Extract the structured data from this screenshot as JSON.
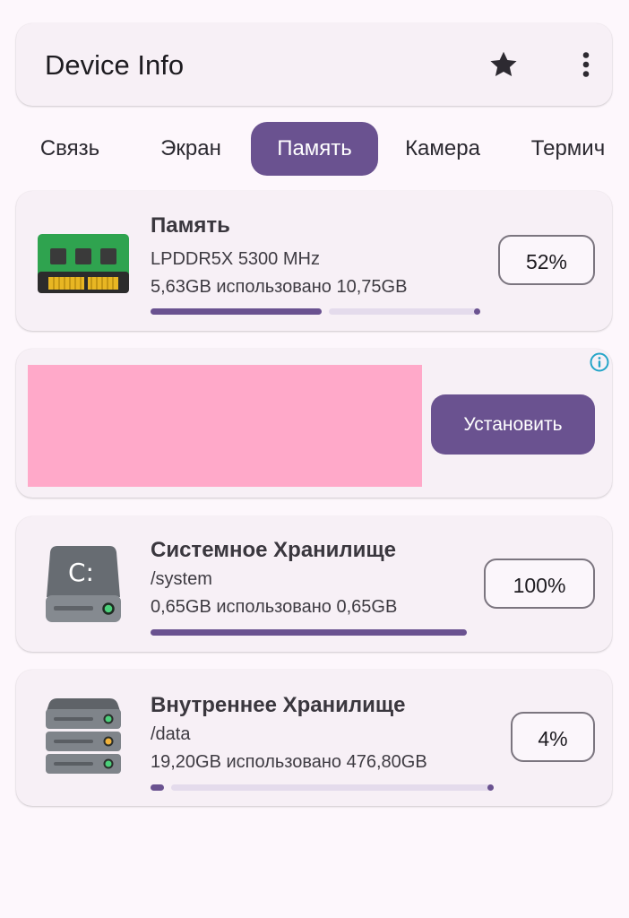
{
  "app": {
    "title": "Device Info",
    "icons": [
      "star-icon",
      "more-vert-icon"
    ]
  },
  "tabs": [
    {
      "label": "Связь",
      "active": false
    },
    {
      "label": "Экран",
      "active": false
    },
    {
      "label": "Память",
      "active": true
    },
    {
      "label": "Камера",
      "active": false
    },
    {
      "label": "Термич",
      "active": false
    }
  ],
  "memory": {
    "title": "Память",
    "type": "LPDDR5X 5300 MHz",
    "usage": "5,63GB использовано 10,75GB",
    "percent_label": "52%",
    "percent": 52,
    "icon": "ram-chip-icon"
  },
  "ad": {
    "button_label": "Установить",
    "image_color": "#ffa9c9",
    "icon": "info-icon"
  },
  "system_storage": {
    "title": "Системное Хранилище",
    "path": "/system",
    "usage": "0,65GB использовано 0,65GB",
    "percent_label": "100%",
    "percent": 100,
    "drive_letter": "C:",
    "icon": "hard-drive-icon"
  },
  "internal_storage": {
    "title": "Внутреннее Хранилище",
    "path": "/data",
    "usage": "19,20GB использовано 476,80GB",
    "percent_label": "4%",
    "percent": 4,
    "icon": "server-stack-icon"
  },
  "colors": {
    "accent": "#6a5290",
    "track": "#e4dbec",
    "card": "#f7f0f6",
    "background": "#fdf7fc"
  }
}
